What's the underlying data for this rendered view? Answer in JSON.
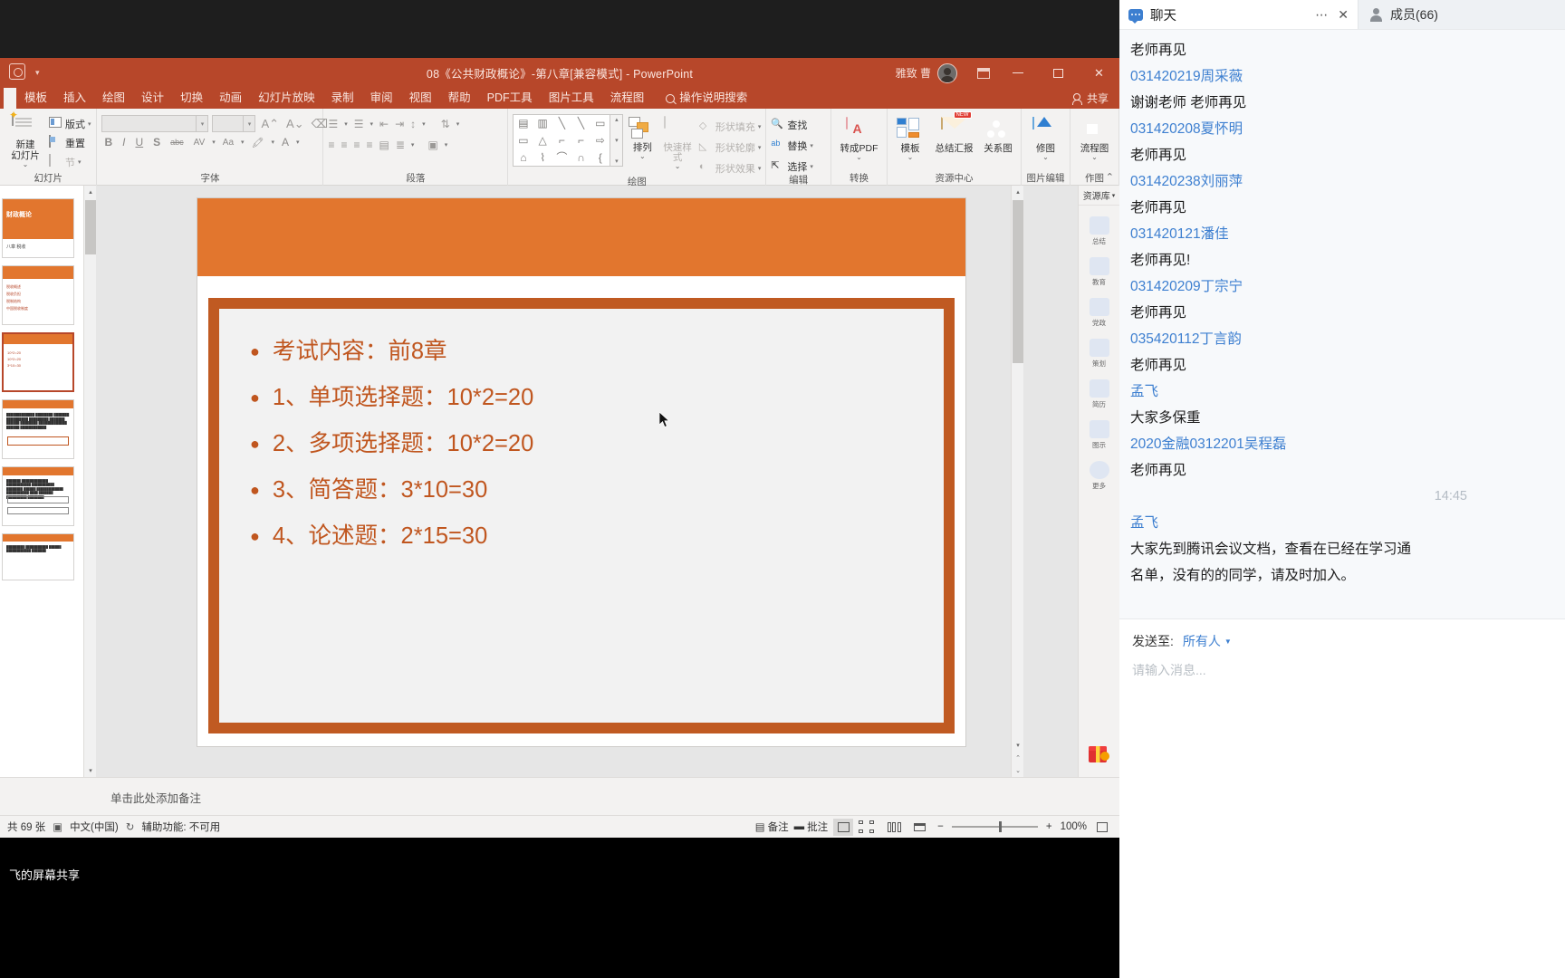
{
  "ppt": {
    "title": "08《公共财政概论》-第八章[兼容模式]  -  PowerPoint",
    "account_name": "雅致 曹",
    "share_label": "共享",
    "tabs": [
      "模板",
      "插入",
      "绘图",
      "设计",
      "切换",
      "动画",
      "幻灯片放映",
      "录制",
      "审阅",
      "视图",
      "帮助",
      "PDF工具",
      "图片工具",
      "流程图"
    ],
    "search_tab": "操作说明搜索",
    "groups": {
      "slide": {
        "label": "幻灯片",
        "new_slide": "新建\n幻灯片",
        "new_slide_l1": "新建",
        "new_slide_l2": "幻灯片",
        "layout": "版式",
        "reset": "重置",
        "section": "节"
      },
      "font": {
        "label": "字体",
        "font_name": "",
        "font_size": "",
        "grow": "A",
        "shrink": "A",
        "clear_fmt": "A",
        "bold": "B",
        "italic": "I",
        "underline": "U",
        "shadow": "S",
        "strike": "abc",
        "spacing": "AV",
        "case": "Aa",
        "highlight": "A",
        "color": "A"
      },
      "paragraph": {
        "label": "段落"
      },
      "drawing": {
        "label": "绘图",
        "arrange": "排列",
        "quick_styles": "快速样式",
        "shape_fill": "形状填充",
        "shape_outline": "形状轮廓",
        "shape_effects": "形状效果"
      },
      "editing": {
        "label": "编辑",
        "find": "查找",
        "replace": "替换",
        "select": "选择"
      },
      "convert": {
        "label": "转换",
        "to_pdf": "转成PDF"
      },
      "resource": {
        "label": "资源中心",
        "template": "模板",
        "report": "总结汇报",
        "relation": "关系图",
        "new_badge": "NEW"
      },
      "picture_edit": {
        "label": "图片编辑",
        "repair": "修图"
      },
      "draw_tools": {
        "label": "作图",
        "flowchart": "流程图"
      }
    },
    "rail": {
      "library": "资源库",
      "items": [
        {
          "label": "总结"
        },
        {
          "label": "教育"
        },
        {
          "label": "党政"
        },
        {
          "label": "策划"
        },
        {
          "label": "简历"
        },
        {
          "label": "图示"
        },
        {
          "label": "更多"
        }
      ]
    },
    "slide": {
      "bullets": [
        "考试内容：前8章",
        "1、单项选择题：10*2=20",
        "2、多项选择题：10*2=20",
        "3、简答题：3*10=30",
        "4、论述题：2*15=30"
      ]
    },
    "thumbnails": [
      {
        "title": "财政概论",
        "sub": "八章  税收",
        "type": "title"
      },
      {
        "lines": [
          "税收概述",
          "税收负担",
          "税制结构",
          "中国税收制度"
        ],
        "type": "toc"
      },
      {
        "lines": [
          "10*2=20",
          "10*2=20",
          "3*10=30"
        ],
        "type": "content",
        "selected": true
      },
      {
        "type": "dense"
      },
      {
        "type": "dense2"
      },
      {
        "type": "partial"
      }
    ],
    "notes_placeholder": "单击此处添加备注",
    "status": {
      "slide_count": "共 69 张",
      "language": "中文(中国)",
      "accessibility": "辅助功能: 不可用",
      "notes_button": "备注",
      "comments_button": "批注",
      "zoom_level": "100%"
    },
    "screen_share_label": "飞的屏幕共享"
  },
  "chat": {
    "tab_title": "聊天",
    "members_label": "成员(66)",
    "messages": [
      {
        "kind": "text",
        "value": "老师再见"
      },
      {
        "kind": "name",
        "value": "031420219周采薇"
      },
      {
        "kind": "text",
        "value": "谢谢老师 老师再见"
      },
      {
        "kind": "name",
        "value": "031420208夏怀明"
      },
      {
        "kind": "text",
        "value": "老师再见"
      },
      {
        "kind": "name",
        "value": "031420238刘丽萍"
      },
      {
        "kind": "text",
        "value": "老师再见"
      },
      {
        "kind": "name",
        "value": "031420121潘佳"
      },
      {
        "kind": "text",
        "value": "老师再见!"
      },
      {
        "kind": "name",
        "value": "031420209丁宗宁"
      },
      {
        "kind": "text",
        "value": "老师再见"
      },
      {
        "kind": "name",
        "value": "035420112丁言韵"
      },
      {
        "kind": "text",
        "value": "老师再见"
      },
      {
        "kind": "name",
        "value": "孟飞"
      },
      {
        "kind": "text",
        "value": "大家多保重"
      },
      {
        "kind": "name",
        "value": "2020金融0312201吴程磊"
      },
      {
        "kind": "text",
        "value": "老师再见"
      },
      {
        "kind": "time",
        "value": "14:45"
      },
      {
        "kind": "name",
        "value": "孟飞"
      },
      {
        "kind": "text",
        "value": "大家先到腾讯会议文档，查看在已经在学习通"
      },
      {
        "kind": "text",
        "value": "名单，没有的的同学，请及时加入。"
      }
    ],
    "send_to_label": "发送至:",
    "send_to_value": "所有人",
    "input_placeholder": "请输入消息..."
  },
  "colors": {
    "ppt_accent": "#b7472a",
    "slide_orange": "#e2762e",
    "slide_frame": "#c05a22",
    "bullet_text": "#c0561f",
    "chat_link": "#3d7fd0"
  }
}
